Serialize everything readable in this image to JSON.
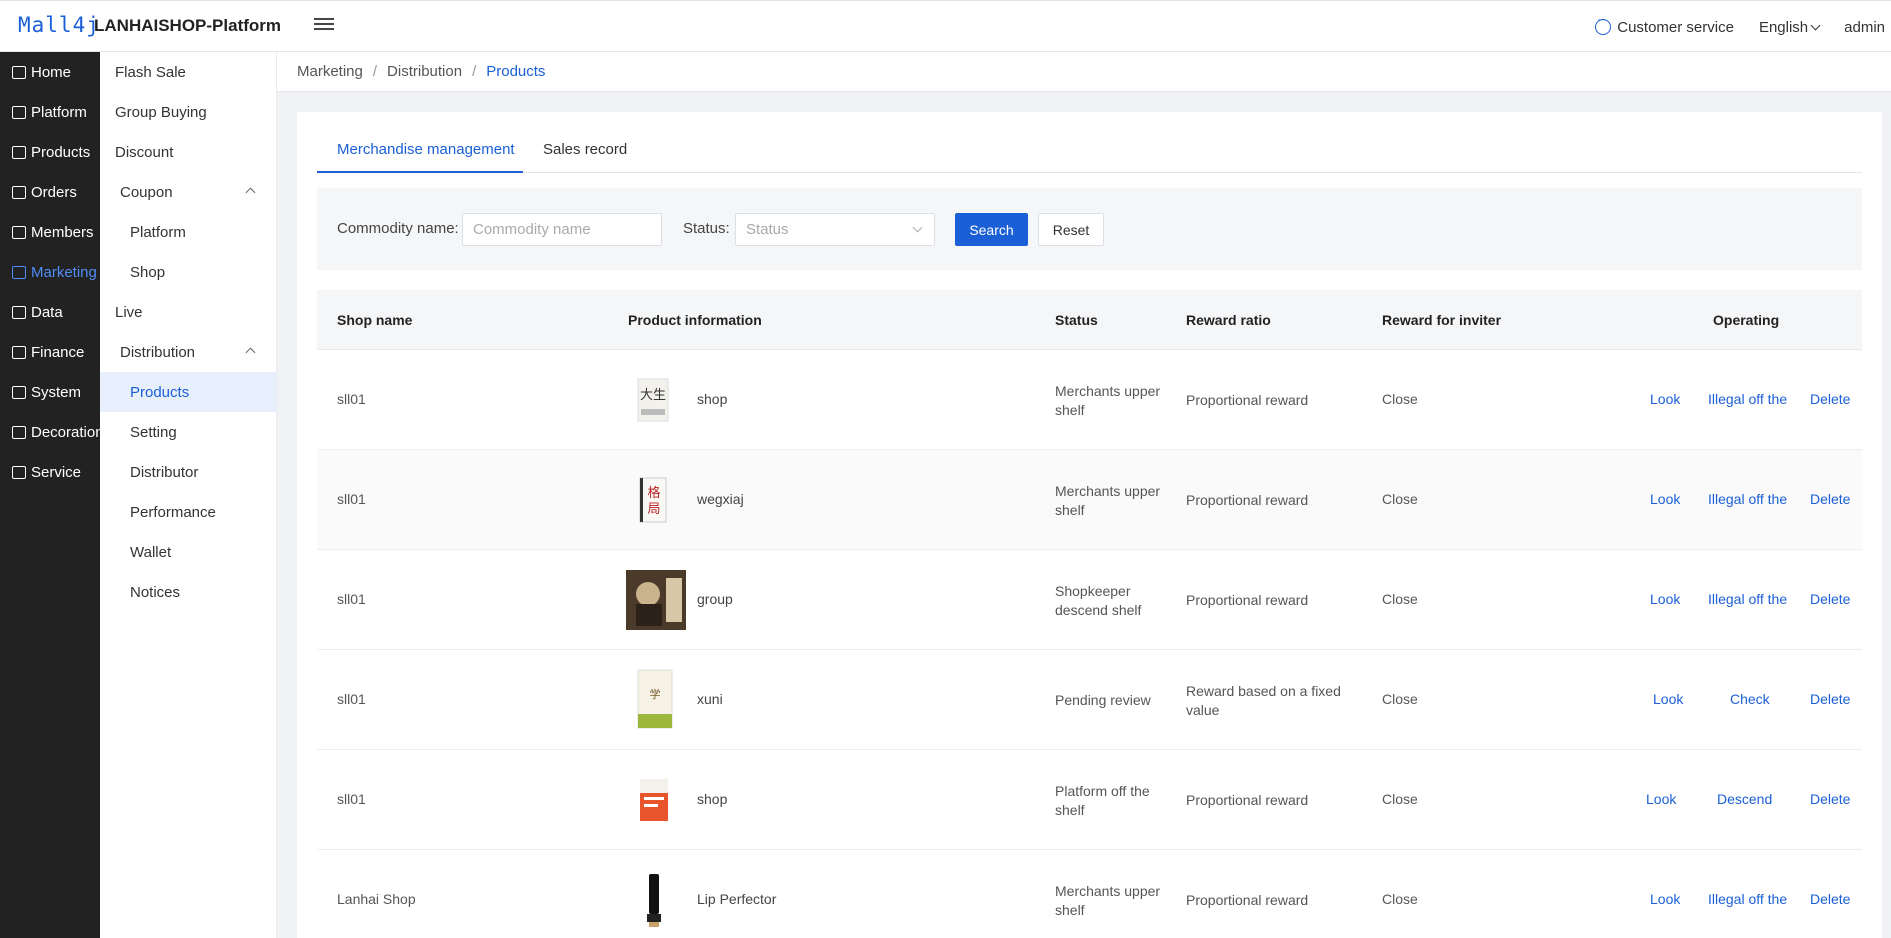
{
  "header": {
    "logo": "Mall4j",
    "title": "LANHAISHOP-Platform",
    "customer_service": "Customer service",
    "language": "English",
    "user": "admin"
  },
  "sidebar": {
    "items": [
      {
        "label": "Home",
        "icon": "home-icon"
      },
      {
        "label": "Platform",
        "icon": "monitor-icon"
      },
      {
        "label": "Products",
        "icon": "bag-icon"
      },
      {
        "label": "Orders",
        "icon": "document-icon"
      },
      {
        "label": "Members",
        "icon": "users-icon"
      },
      {
        "label": "Marketing",
        "icon": "gift-icon"
      },
      {
        "label": "Data",
        "icon": "chart-icon"
      },
      {
        "label": "Finance",
        "icon": "ledger-icon"
      },
      {
        "label": "System",
        "icon": "gear-icon"
      },
      {
        "label": "Decoration",
        "icon": "brush-icon"
      },
      {
        "label": "Service",
        "icon": "chat-icon"
      }
    ],
    "active": "Marketing"
  },
  "subnav": {
    "items": [
      "Flash Sale",
      "Group Buying",
      "Discount",
      "Coupon",
      "Platform",
      "Shop",
      "Live",
      "Distribution",
      "Products",
      "Setting",
      "Distributor",
      "Performance",
      "Wallet",
      "Notices"
    ]
  },
  "breadcrumb": [
    "Marketing",
    "Distribution",
    "Products"
  ],
  "tabs": [
    "Merchandise management",
    "Sales record"
  ],
  "filter": {
    "name_label": "Commodity name:",
    "name_placeholder": "Commodity name",
    "status_label": "Status:",
    "status_placeholder": "Status",
    "search": "Search",
    "reset": "Reset"
  },
  "table": {
    "headers": [
      "Shop name",
      "Product information",
      "Status",
      "Reward ratio",
      "Reward for inviter",
      "Operating"
    ],
    "rows": [
      {
        "shop": "sll01",
        "product": "shop",
        "status": "Merchants upper shelf",
        "ratio": "Proportional reward",
        "inviter": "Close",
        "ops": [
          "Look",
          "Illegal off the",
          "Delete"
        ]
      },
      {
        "shop": "sll01",
        "product": "wegxiaj",
        "status": "Merchants upper shelf",
        "ratio": "Proportional reward",
        "inviter": "Close",
        "ops": [
          "Look",
          "Illegal off the",
          "Delete"
        ]
      },
      {
        "shop": "sll01",
        "product": "group",
        "status": "Shopkeeper descend shelf",
        "ratio": "Proportional reward",
        "inviter": "Close",
        "ops": [
          "Look",
          "Illegal off the",
          "Delete"
        ]
      },
      {
        "shop": "sll01",
        "product": "xuni",
        "status": "Pending review",
        "ratio": "Reward based on a fixed value",
        "inviter": "Close",
        "ops": [
          "Look",
          "Check",
          "Delete"
        ]
      },
      {
        "shop": "sll01",
        "product": "shop",
        "status": "Platform off the shelf",
        "ratio": "Proportional reward",
        "inviter": "Close",
        "ops": [
          "Look",
          "Descend",
          "Delete"
        ]
      },
      {
        "shop": "Lanhai Shop",
        "product": "Lip Perfector",
        "status": "Merchants upper shelf",
        "ratio": "Proportional reward",
        "inviter": "Close",
        "ops": [
          "Look",
          "Illegal off the",
          "Delete"
        ]
      }
    ]
  }
}
